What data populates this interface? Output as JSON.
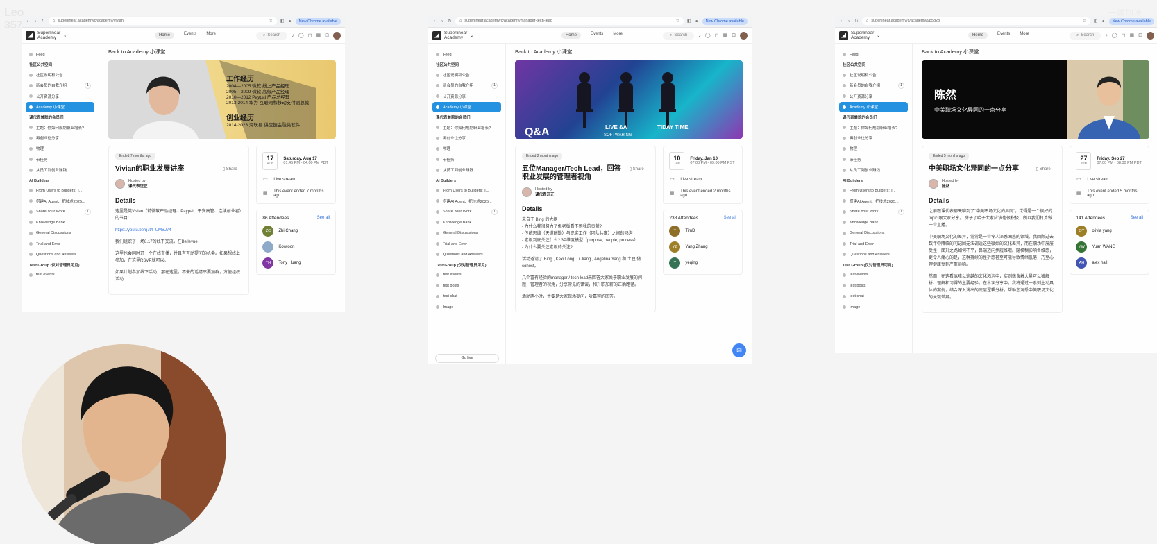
{
  "watermark": {
    "left": "Leo\n357",
    "right": "一维加速"
  },
  "windows": [
    {
      "url": "superlinear.academy/c/academy/vivian",
      "chrome_chip": "New Chrome available",
      "brand": "Superlinear\nAcademy",
      "nav": [
        "Home",
        "Events",
        "More"
      ],
      "search": "Search",
      "sidebar": {
        "items": [
          {
            "label": "Feed"
          },
          {
            "group": "社区公共空间"
          },
          {
            "label": "社区说明和公告"
          },
          {
            "label": "新会员的自我介绍",
            "count": "1"
          },
          {
            "label": "公开资源分享"
          },
          {
            "label": "Academy 小课堂",
            "active": true
          },
          {
            "group": "课代表兼貌的会员们"
          },
          {
            "label": "主题：你如何规划职业增长?"
          },
          {
            "label": "再创业让分享"
          },
          {
            "label": "物理"
          },
          {
            "label": "带任务"
          },
          {
            "label": "从员工到创业赚钱"
          },
          {
            "group": "AI Builders"
          },
          {
            "label": "From Users to Builders: T..."
          },
          {
            "label": "搭建AI Agent、把技术2025..."
          },
          {
            "label": "Share Your Work",
            "count": "1"
          },
          {
            "label": "Knowledge Bank"
          },
          {
            "label": "General Discussions"
          },
          {
            "label": "Trial and Error"
          },
          {
            "label": "Questions and Answers"
          },
          {
            "group": "Test Group (仅对管理员可见)"
          },
          {
            "label": "test events"
          }
        ]
      },
      "back": "Back to Academy 小课堂",
      "banner": {
        "type": "portrait",
        "heading1": "工作经历",
        "lines": [
          "2004—2005 微软 线上产品经理",
          "2005—2009 微软 高级产品经理",
          "2010—2012 Paypal 产品总经理",
          "2013-2014 华为 互联网和移动支付副总裁"
        ],
        "heading2": "创业经历",
        "line2": "2014-2023 海联易 供应链金融类软件"
      },
      "event": {
        "status": "Ended 7 months ago",
        "title": "Vivian的职业发展讲座",
        "share": "Share",
        "hosted_by": "Hosted by",
        "host": "课代表汪正",
        "details_heading": "Details",
        "details": [
          {
            "text": "这里是英Vivian（前微软产品经理、Paypal、平安高管、连续创业者）的节目:"
          },
          {
            "text": "https://youtu.be/q7t4_UMBJ74",
            "link": true
          },
          {
            "text": "我们组织了一场8.17的线下交流，在Bellevue"
          },
          {
            "text": "这里也会同时开一个在线直播，并且有互动提问的机会。如果想线上参加，在这里RSVP就可以。"
          },
          {
            "text": "如果计划参加线下活动，那在这里，不来的话请不要加群，方便组织活动"
          }
        ]
      },
      "date": {
        "day": "17",
        "month": "AUG",
        "title": "Saturday, Aug 17",
        "time": "01:45 PM - 04:00 PM PDT"
      },
      "location": "Live stream",
      "ended": "This event ended 7 months ago",
      "attendees": {
        "count": "86 Attendees",
        "see_all": "See all",
        "list": [
          {
            "initials": "ZC",
            "name": "Zhi Chang",
            "color": "#6b7d2f"
          },
          {
            "initials": "",
            "name": "Kowloon",
            "color": "#8aa7c7"
          },
          {
            "initials": "TH",
            "name": "Tony Huang",
            "color": "#7d2fa0"
          }
        ]
      }
    },
    {
      "url": "superlinear.academy/c/academy/manager-tech-lead",
      "chrome_chip": "New Chrome available",
      "brand": "Superlinear\nAcademy",
      "nav": [
        "Home",
        "Events",
        "More"
      ],
      "search": "Search",
      "sidebar": {
        "items": [
          {
            "label": "Feed"
          },
          {
            "group": "社区公共空间"
          },
          {
            "label": "社区说明和公告"
          },
          {
            "label": "新会员的自我介绍",
            "count": "1"
          },
          {
            "label": "公开资源分享"
          },
          {
            "label": "Academy 小课堂",
            "active": true
          },
          {
            "group": "课代表兼貌的会员们"
          },
          {
            "label": "主题：你如何规划职业增长?"
          },
          {
            "label": "再创业让分享"
          },
          {
            "label": "物理"
          },
          {
            "label": "带任务"
          },
          {
            "label": "从员工到创业赚钱"
          },
          {
            "group": "AI Builders"
          },
          {
            "label": "From Users to Builders: T..."
          },
          {
            "label": "搭建AI Agent、把技术2025..."
          },
          {
            "label": "Share Your Work",
            "count": "1"
          },
          {
            "label": "Knowledge Bank"
          },
          {
            "label": "General Discussions"
          },
          {
            "label": "Trial and Error"
          },
          {
            "label": "Questions and Answers"
          },
          {
            "group": "Test Group (仅对管理员可见)"
          },
          {
            "label": "test events"
          },
          {
            "label": "test posts"
          },
          {
            "label": "test chat"
          },
          {
            "label": "Image"
          }
        ],
        "go_live": "Go live"
      },
      "back": "Back to Academy 小课堂",
      "banner": {
        "type": "qa",
        "text1": "Q&A",
        "text2": "LIVE &A",
        "text3": "SOFTWARING",
        "text4": "TIDAY TIME"
      },
      "event": {
        "status": "Ended 2 months ago",
        "title": "五位Manager/Tech Lead，回答职业发展的管理者视角",
        "share": "Share",
        "hosted_by": "Hosted by",
        "host": "课代表汪正",
        "details_heading": "Details",
        "details": [
          {
            "text": "来自于 Bing 的大纲\n- 为什么我很努力了但老板看不到我的贡献?\n- 传统思维（天道酬勤）与现实工作（团队共赢）之间的鸿沟\n- 老板到底关注什么? 3P维度模型（purpose, people, process）\n- 为什么要关注老板的关注?"
          },
          {
            "text": "活动邀请了 Bing , Kexi Long, Li Jiang , Angelina Yang 和 土豆 做cohost。"
          },
          {
            "text": "几个富有经验的manager / tech lead来回答大家关于职业发展的问题，管理者的视角，分享常见的错误，和升职加薪的正确路径。"
          },
          {
            "text": "活动两小时，主要是大家现场提问，听嘉宾的回答。"
          }
        ]
      },
      "date": {
        "day": "10",
        "month": "JAN",
        "title": "Friday, Jan 10",
        "time": "07:00 PM - 09:00 PM PST"
      },
      "location": "Live stream",
      "ended": "This event ended 2 months ago",
      "attendees": {
        "count": "238 Attendees",
        "see_all": "See all",
        "list": [
          {
            "initials": "T",
            "name": "TimD",
            "color": "#8a6a1f"
          },
          {
            "initials": "YZ",
            "name": "Yang Zhang",
            "color": "#9a7b1f"
          },
          {
            "initials": "Y",
            "name": "yeqing",
            "color": "#2f6e4f"
          }
        ]
      }
    },
    {
      "url": "superlinear.academy/c/academy/985d28",
      "chrome_chip": "New Chrome available",
      "brand": "Superlinear\nAcademy",
      "nav": [
        "Home",
        "Events",
        "More"
      ],
      "search": "Search",
      "sidebar": {
        "items": [
          {
            "label": "Feed"
          },
          {
            "group": "社区公共空间"
          },
          {
            "label": "社区说明和公告"
          },
          {
            "label": "新会员的自我介绍",
            "count": "1"
          },
          {
            "label": "公开资源分享"
          },
          {
            "label": "Academy 小课堂",
            "active": true
          },
          {
            "group": "课代表兼貌的会员们"
          },
          {
            "label": "主题：你如何规划职业增长?"
          },
          {
            "label": "再创业让分享"
          },
          {
            "label": "物理"
          },
          {
            "label": "带任务"
          },
          {
            "label": "从员工到创业赚钱"
          },
          {
            "group": "AI Builders"
          },
          {
            "label": "From Users to Builders: T..."
          },
          {
            "label": "搭建AI Agent、把技术2025..."
          },
          {
            "label": "Share Your Work",
            "count": "1"
          },
          {
            "label": "Knowledge Bank"
          },
          {
            "label": "General Discussions"
          },
          {
            "label": "Trial and Error"
          },
          {
            "label": "Questions and Answers"
          },
          {
            "group": "Test Group (仅对管理员可见)"
          },
          {
            "label": "test events"
          },
          {
            "label": "test posts"
          },
          {
            "label": "test chat"
          },
          {
            "label": "Image"
          }
        ]
      },
      "back": "Back to Academy 小课堂",
      "banner": {
        "type": "speaker",
        "name": "陈然",
        "subtitle": "中美职场文化异同的一点分享"
      },
      "event": {
        "status": "Ended 5 months ago",
        "title": "中美职场文化异同的一点分享",
        "share": "Share",
        "hosted_by": "Hosted by",
        "host": "陈然",
        "details_heading": "Details",
        "details": [
          {
            "text": "之前跟课代表聊天聊到了\"中美职场文化的异同\"，觉得是一个很好的 topic 跟大家分享。 房子了哈子大家应该也很积极，所以我们打算做一个直播。"
          },
          {
            "text": "中美职场文化的差异，常常是一个令人深感困惑的领域。我回顾过去数年中降临的问记因无法调适这些微妙的文化差异，而在职场中屡屡受挫：面升之路如何不平，鼻端迈向步履维艰。隐模糊影响各维感，更令人痛心的是，这种持续的挫折感甚至可能导致情绪低落，乃至心理健康受到严重影响。"
          },
          {
            "text": "然而，在这看似难以逾越的文化鸿沟中，实则蕴含着大量可以被解析、理解和习得的主要经验。在本次分享中，我将通过一系列生动具体的案例，结合深入浅出的底层逻辑分析，帮助您洞悉中美职场文化的关键差异。"
          }
        ]
      },
      "date": {
        "day": "27",
        "month": "SEP",
        "title": "Friday, Sep 27",
        "time": "07:00 PM - 08:30 PM PDT"
      },
      "location": "Live stream",
      "ended": "This event ended 5 months ago",
      "attendees": {
        "count": "141 Attendees",
        "see_all": "See all",
        "list": [
          {
            "initials": "OY",
            "name": "olivia yang",
            "color": "#9a7b1f"
          },
          {
            "initials": "YW",
            "name": "Yuan WANG",
            "color": "#2f6e2f"
          },
          {
            "initials": "AH",
            "name": "alex hall",
            "color": "#3b4fb0"
          }
        ]
      }
    }
  ]
}
